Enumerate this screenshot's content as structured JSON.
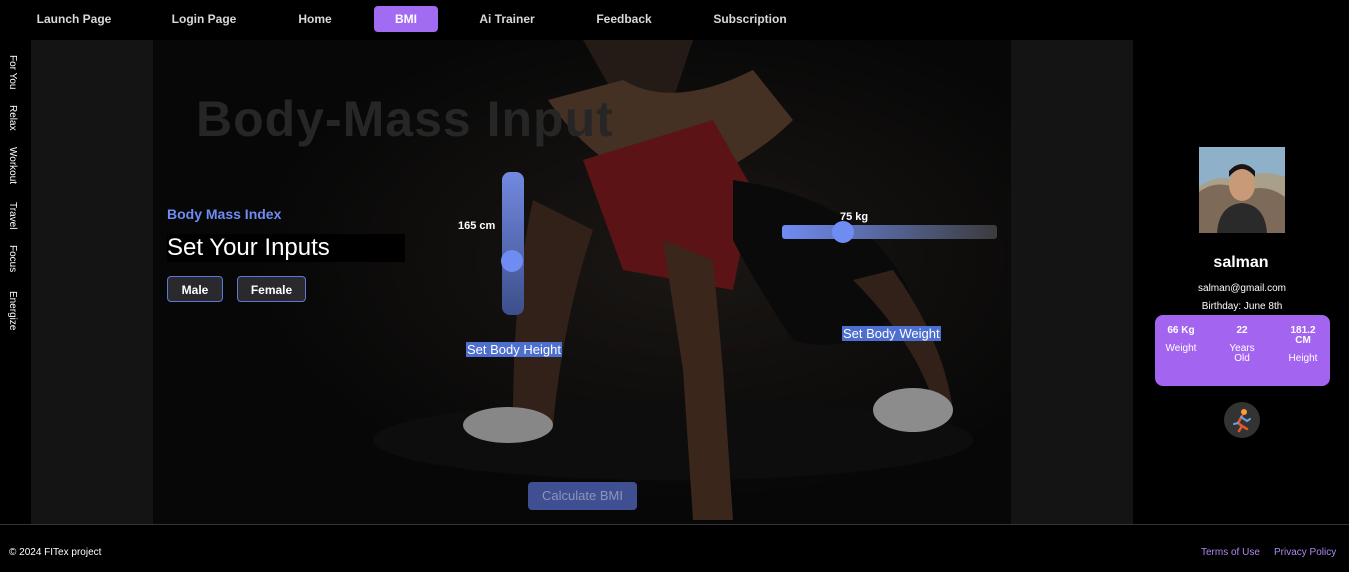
{
  "nav": {
    "items": [
      {
        "label": "Launch Page"
      },
      {
        "label": "Login Page"
      },
      {
        "label": "Home"
      },
      {
        "label": "BMI"
      },
      {
        "label": "Ai Trainer"
      },
      {
        "label": "Feedback"
      },
      {
        "label": "Subscription"
      }
    ],
    "active": "BMI"
  },
  "sidebar": {
    "items": [
      {
        "label": "For You"
      },
      {
        "label": "Relax"
      },
      {
        "label": "Workout"
      },
      {
        "label": "Travel"
      },
      {
        "label": "Focus"
      },
      {
        "label": "Energize"
      }
    ]
  },
  "main": {
    "watermark": "Body-Mass Input",
    "section_label": "Body Mass Index",
    "title": "Set Your Inputs",
    "gender_buttons": {
      "male": "Male",
      "female": "Female"
    },
    "height": {
      "value_label": "165 cm",
      "set_label": "Set Body Height",
      "level": 0.5
    },
    "weight": {
      "value_label": "75 kg",
      "set_label": "Set Body Weight",
      "level": 0.25
    },
    "calculate_label": "Calculate BMI"
  },
  "profile": {
    "name": "salman",
    "email": "salman@gmail.com",
    "birthday": "Birthday: June 8th",
    "stats": [
      {
        "value": "66 Kg",
        "label": "Weight"
      },
      {
        "value": "22",
        "label": "Years Old"
      },
      {
        "value": "181.2 CM",
        "label": "Height"
      }
    ],
    "action_icon": "running-person-icon"
  },
  "footer": {
    "copyright": "© 2024 FITex project",
    "links": {
      "terms": "Terms of Use",
      "privacy": "Privacy Policy"
    }
  },
  "colors": {
    "accent_purple": "#a16cf2",
    "accent_blue": "#6f8cf2",
    "link_purple": "#a98af0"
  }
}
